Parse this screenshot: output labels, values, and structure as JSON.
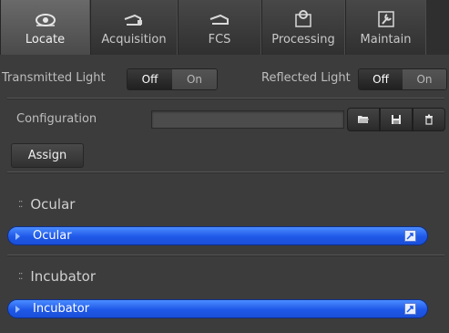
{
  "tabs": [
    {
      "label": "Locate",
      "icon": "eye-icon",
      "active": true
    },
    {
      "label": "Acquisition",
      "icon": "microscope-icon",
      "active": false
    },
    {
      "label": "FCS",
      "icon": "fcs-icon",
      "active": false
    },
    {
      "label": "Processing",
      "icon": "processing-icon",
      "active": false
    },
    {
      "label": "Maintain",
      "icon": "wrench-icon",
      "active": false
    }
  ],
  "transmitted": {
    "label": "Transmitted Light",
    "off": "Off",
    "on": "On",
    "selected": "Off"
  },
  "reflected": {
    "label": "Reflected Light",
    "off": "Off",
    "on": "On",
    "selected": "Off"
  },
  "configuration": {
    "label": "Configuration",
    "value": ""
  },
  "assign_label": "Assign",
  "sections": [
    {
      "title": "Ocular",
      "bar": "Ocular"
    },
    {
      "title": "Incubator",
      "bar": "Incubator"
    }
  ],
  "colors": {
    "accent": "#1f58e8",
    "panel": "#3c3c3c"
  }
}
